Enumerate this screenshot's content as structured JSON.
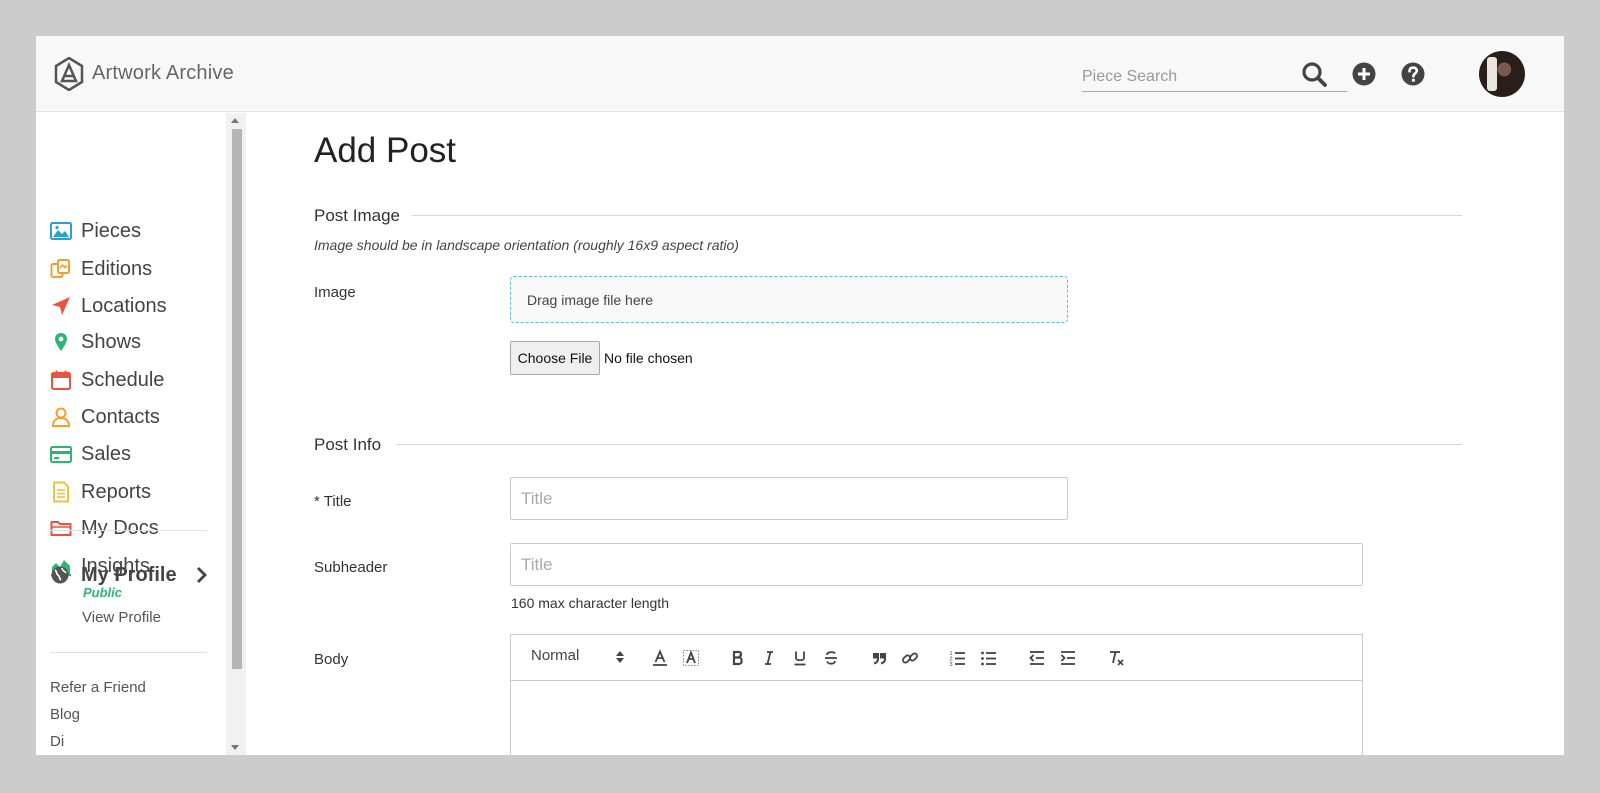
{
  "app": {
    "brand": "Artwork Archive"
  },
  "header": {
    "search_placeholder": "Piece Search",
    "icons": [
      "search-icon",
      "plus-circle-icon",
      "help-circle-icon"
    ]
  },
  "sidebar": {
    "items": [
      {
        "label": "Pieces",
        "icon": "image-icon",
        "color": "#2a9fd6"
      },
      {
        "label": "Editions",
        "icon": "editions-icon",
        "color": "#f0a030"
      },
      {
        "label": "Locations",
        "icon": "location-arrow-icon",
        "color": "#e8543f"
      },
      {
        "label": "Shows",
        "icon": "map-pin-icon",
        "color": "#2bb673"
      },
      {
        "label": "Schedule",
        "icon": "calendar-icon",
        "color": "#e8543f"
      },
      {
        "label": "Contacts",
        "icon": "user-icon",
        "color": "#f0a030"
      },
      {
        "label": "Sales",
        "icon": "credit-card-icon",
        "color": "#2bb673"
      },
      {
        "label": "Reports",
        "icon": "document-icon",
        "color": "#f0c040"
      },
      {
        "label": "My Docs",
        "icon": "folder-icon",
        "color": "#e8543f"
      },
      {
        "label": "Insights",
        "icon": "area-chart-icon",
        "color": "#2bb673"
      }
    ],
    "profile": {
      "label": "My Profile",
      "status": "Public",
      "view_link": "View Profile"
    },
    "footer_links": [
      "Refer a Friend",
      "Blog",
      "Di"
    ]
  },
  "main": {
    "title": "Add Post",
    "post_image": {
      "section": "Post Image",
      "hint": "Image should be in landscape orientation (roughly 16x9 aspect ratio)",
      "label": "Image",
      "dropzone_text": "Drag image file here",
      "choose_file": "Choose File",
      "no_file": "No file chosen"
    },
    "post_info": {
      "section": "Post Info",
      "title_label": "* Title",
      "title_placeholder": "Title",
      "subheader_label": "Subheader",
      "subheader_placeholder": "Title",
      "subheader_hint": "160 max character length",
      "body_label": "Body",
      "editor": {
        "format_select": "Normal",
        "tools": [
          "font-color-icon",
          "background-color-icon",
          "bold-icon",
          "italic-icon",
          "underline-icon",
          "strikethrough-icon",
          "blockquote-icon",
          "link-icon",
          "ordered-list-icon",
          "bullet-list-icon",
          "outdent-icon",
          "indent-icon",
          "clear-format-icon"
        ]
      }
    }
  }
}
